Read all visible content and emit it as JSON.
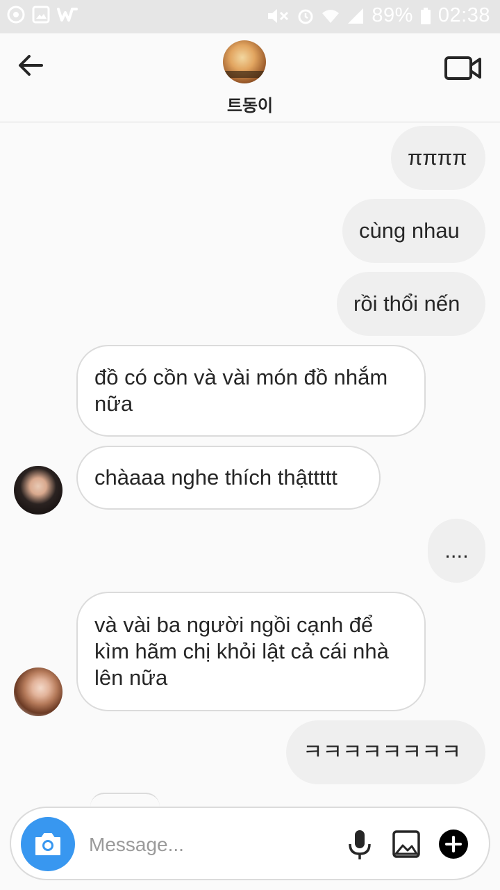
{
  "status_bar": {
    "battery": "89%",
    "time": "02:38",
    "icons": [
      "media-icon",
      "image-icon",
      "wattpad-icon",
      "mute-icon",
      "alarm-icon",
      "wifi-icon",
      "signal-icon",
      "battery-icon"
    ]
  },
  "header": {
    "contact_name": "트동이",
    "back_icon": "arrow-left-icon",
    "video_icon": "video-camera-icon"
  },
  "messages": [
    {
      "direction": "out",
      "text": "ππππ"
    },
    {
      "direction": "out",
      "text": "cùng nhau"
    },
    {
      "direction": "out",
      "text": "rồi thổi nến"
    },
    {
      "direction": "in",
      "text": "đồ có cồn và vài món đồ nhắm nữa"
    },
    {
      "direction": "in",
      "text": "chàaaa nghe thích thậttttt"
    },
    {
      "direction": "out",
      "text": "...."
    },
    {
      "direction": "in",
      "text": "và vài ba người ngồi cạnh để kìm hãm chị khỏi lật cả cái nhà lên nữa"
    },
    {
      "direction": "out",
      "text": "ㅋㅋㅋㅋㅋㅋㅋㅋ"
    }
  ],
  "composer": {
    "placeholder": "Message...",
    "value": "",
    "camera_icon": "camera-icon",
    "mic_icon": "microphone-icon",
    "gallery_icon": "gallery-icon",
    "plus_icon": "plus-icon"
  },
  "colors": {
    "accent": "#3897f0",
    "outgoing_bubble": "#efefef",
    "incoming_border": "#dbdbdb",
    "status_bar": "#e6e6e6"
  }
}
